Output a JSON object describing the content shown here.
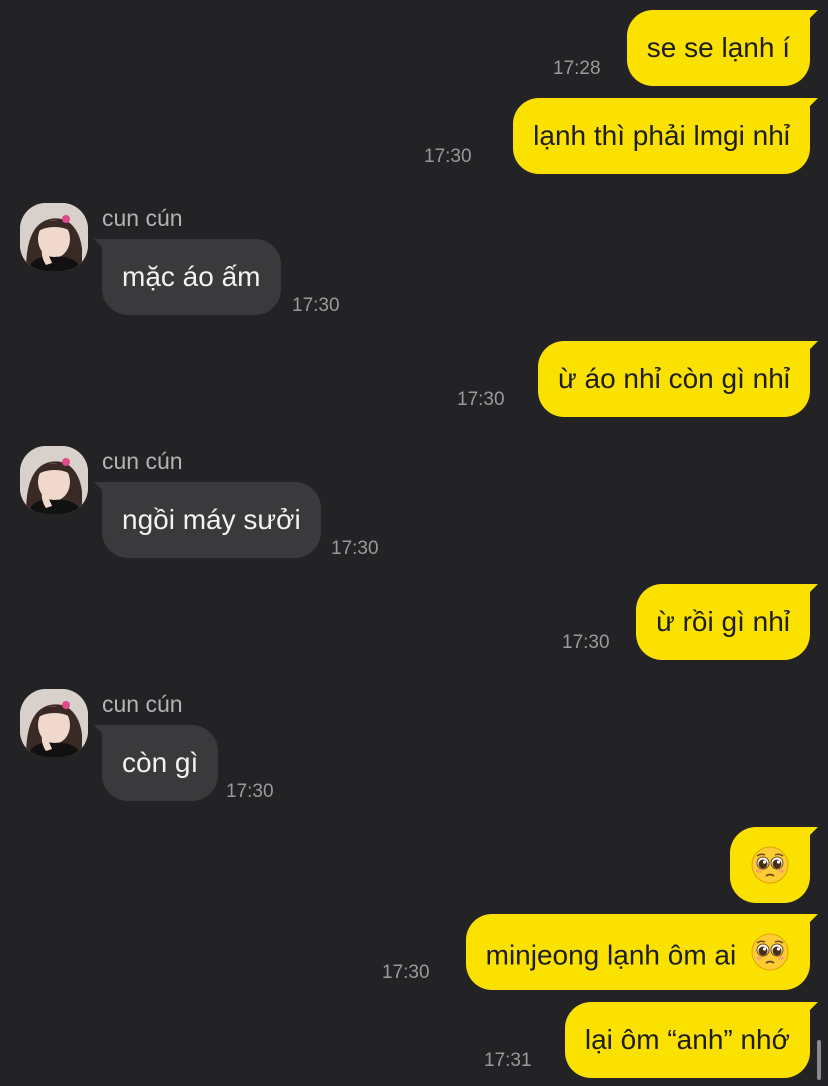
{
  "contact": {
    "name": "cun cún"
  },
  "messages": [
    {
      "direction": "out",
      "text": "se se lạnh í",
      "time": "17:28"
    },
    {
      "direction": "out",
      "text": "lạnh thì phải lmgi nhỉ",
      "time": "17:30"
    },
    {
      "direction": "in",
      "sender": "cun cún",
      "text": "mặc áo ấm",
      "time": "17:30"
    },
    {
      "direction": "out",
      "text": "ừ áo nhỉ còn gì nhỉ",
      "time": "17:30"
    },
    {
      "direction": "in",
      "sender": "cun cún",
      "text": "ngồi máy sưởi",
      "time": "17:30"
    },
    {
      "direction": "out",
      "text": "ừ rồi gì nhỉ",
      "time": "17:30"
    },
    {
      "direction": "in",
      "sender": "cun cún",
      "text": "còn gì",
      "time": "17:30"
    },
    {
      "direction": "out",
      "emoji": "pleading-face-emoji"
    },
    {
      "direction": "out",
      "text": "minjeong lạnh ôm ai",
      "emoji": "pleading-face-emoji",
      "time": "17:30"
    },
    {
      "direction": "out",
      "text": "lại ôm “anh” nhớ",
      "time": "17:31"
    }
  ],
  "colors": {
    "background": "#232325",
    "outgoing_bubble": "#fae100",
    "incoming_bubble": "#3a3a3c",
    "timestamp": "#9a9a9c"
  }
}
